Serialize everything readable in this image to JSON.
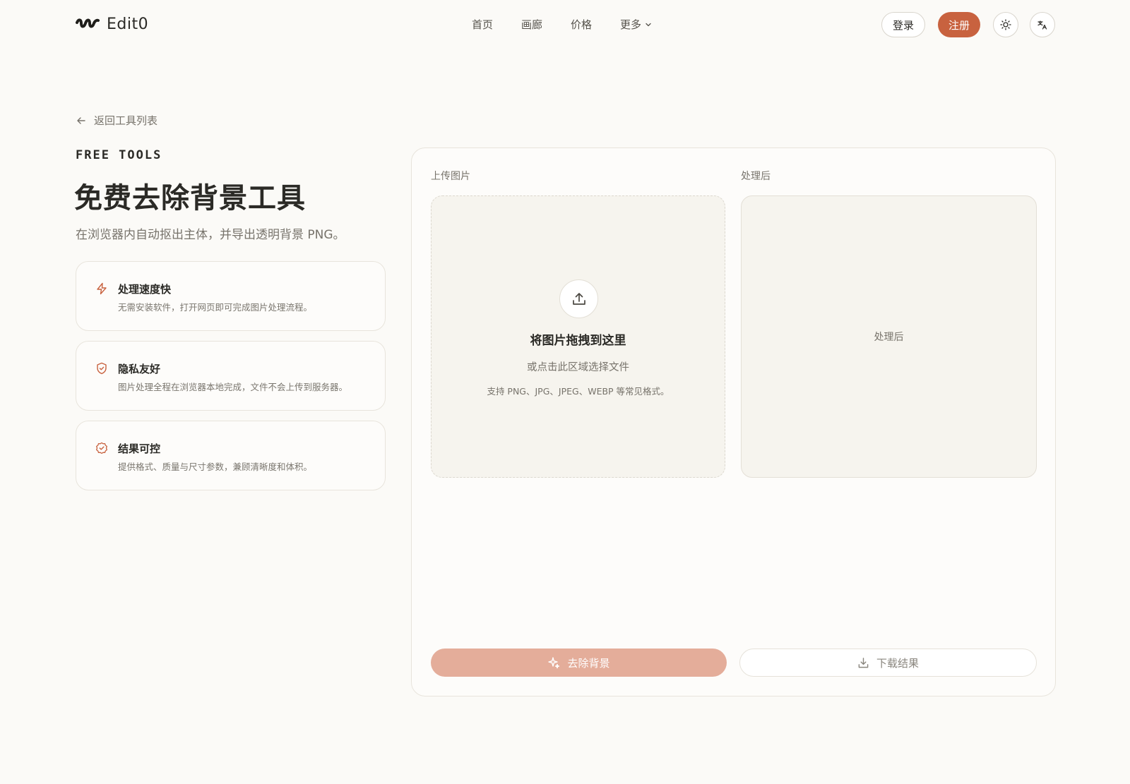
{
  "brand": {
    "name": "Edit0",
    "accent_color": "#c8623f",
    "logo_icon": "wave-logo-icon"
  },
  "nav": {
    "items": [
      {
        "label": "首页"
      },
      {
        "label": "画廊"
      },
      {
        "label": "价格"
      },
      {
        "label": "更多",
        "icon": "chevron-down-icon"
      }
    ]
  },
  "header_actions": {
    "login_label": "登录",
    "signup_label": "注册",
    "theme_icon": "sun-icon",
    "language_icon": "translate-icon"
  },
  "back_link": {
    "label": "返回工具列表",
    "icon": "arrow-left-icon"
  },
  "hero": {
    "eyebrow": "FREE TOOLS",
    "title": "免费去除背景工具",
    "subtitle": "在浏览器内自动抠出主体，并导出透明背景 PNG。"
  },
  "features": [
    {
      "icon": "lightning-icon",
      "title": "处理速度快",
      "desc": "无需安装软件，打开网页即可完成图片处理流程。"
    },
    {
      "icon": "shield-icon",
      "title": "隐私友好",
      "desc": "图片处理全程在浏览器本地完成，文件不会上传到服务器。"
    },
    {
      "icon": "badge-check-icon",
      "title": "结果可控",
      "desc": "提供格式、质量与尺寸参数，兼顾清晰度和体积。"
    }
  ],
  "panel": {
    "upload_label": "上传图片",
    "result_label": "处理后",
    "upload": {
      "icon": "upload-icon",
      "title": "将图片拖拽到这里",
      "subtitle": "或点击此区域选择文件",
      "formats": "支持 PNG、JPG、JPEG、WEBP 等常见格式。"
    },
    "result_placeholder": "处理后",
    "remove_button": {
      "label": "去除背景",
      "icon": "sparkle-icon",
      "color": "#e4ad9a"
    },
    "download_button": {
      "label": "下载结果",
      "icon": "download-icon"
    }
  }
}
